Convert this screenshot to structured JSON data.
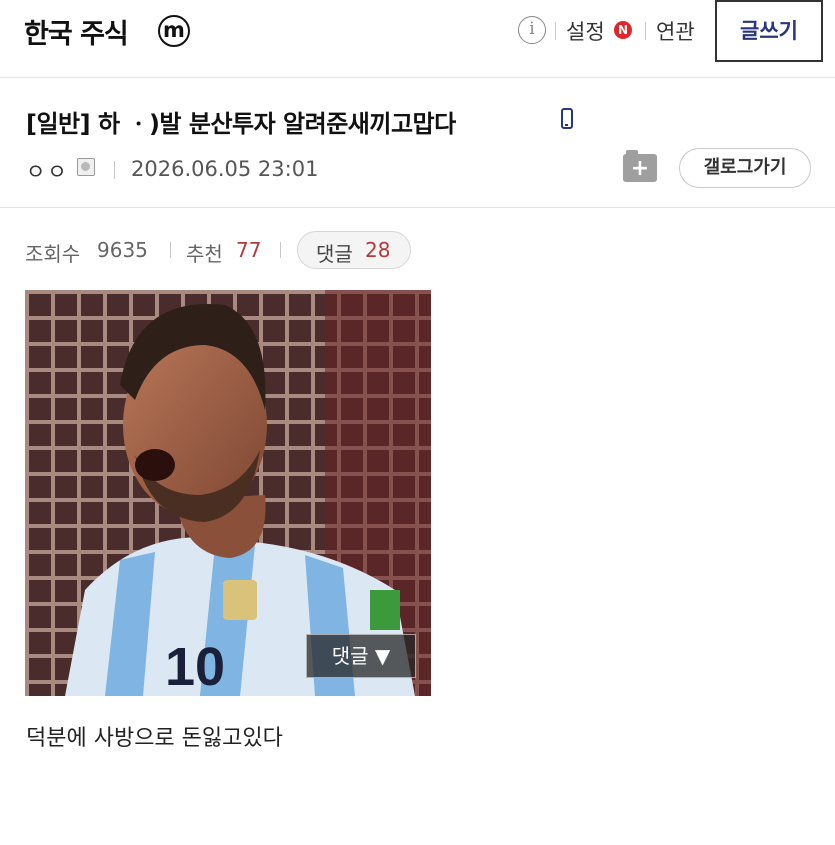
{
  "header": {
    "gallery_title": "한국 주식",
    "minor_badge": "m",
    "info_icon_label": "i",
    "settings_label": "설정",
    "new_badge": "N",
    "related_label": "연관",
    "write_label": "글쓰기"
  },
  "post": {
    "title": "[일반] 하 ㆍ)발 분산투자 알려준새끼고맙다",
    "author": "ㅇㅇ",
    "date": "2026.06.05 23:01",
    "go_gallery_label": "갤로그가기",
    "stats": {
      "views_label": "조회수",
      "views": "9635",
      "recommend_label": "추천",
      "recommend": "77",
      "comments_label": "댓글",
      "comments": "28"
    },
    "image_comment_button": "댓글 ▼",
    "body": "덕분에 사방으로 돈잃고있다"
  },
  "colors": {
    "accent_navy": "#29367c",
    "badge_red": "#e0252b",
    "count_red": "#b33a3a",
    "divider": "#e3e3e3"
  },
  "icons": [
    "minor-gallery-badge-icon",
    "info-icon",
    "mobile-icon",
    "user-icon",
    "add-folder-icon"
  ]
}
